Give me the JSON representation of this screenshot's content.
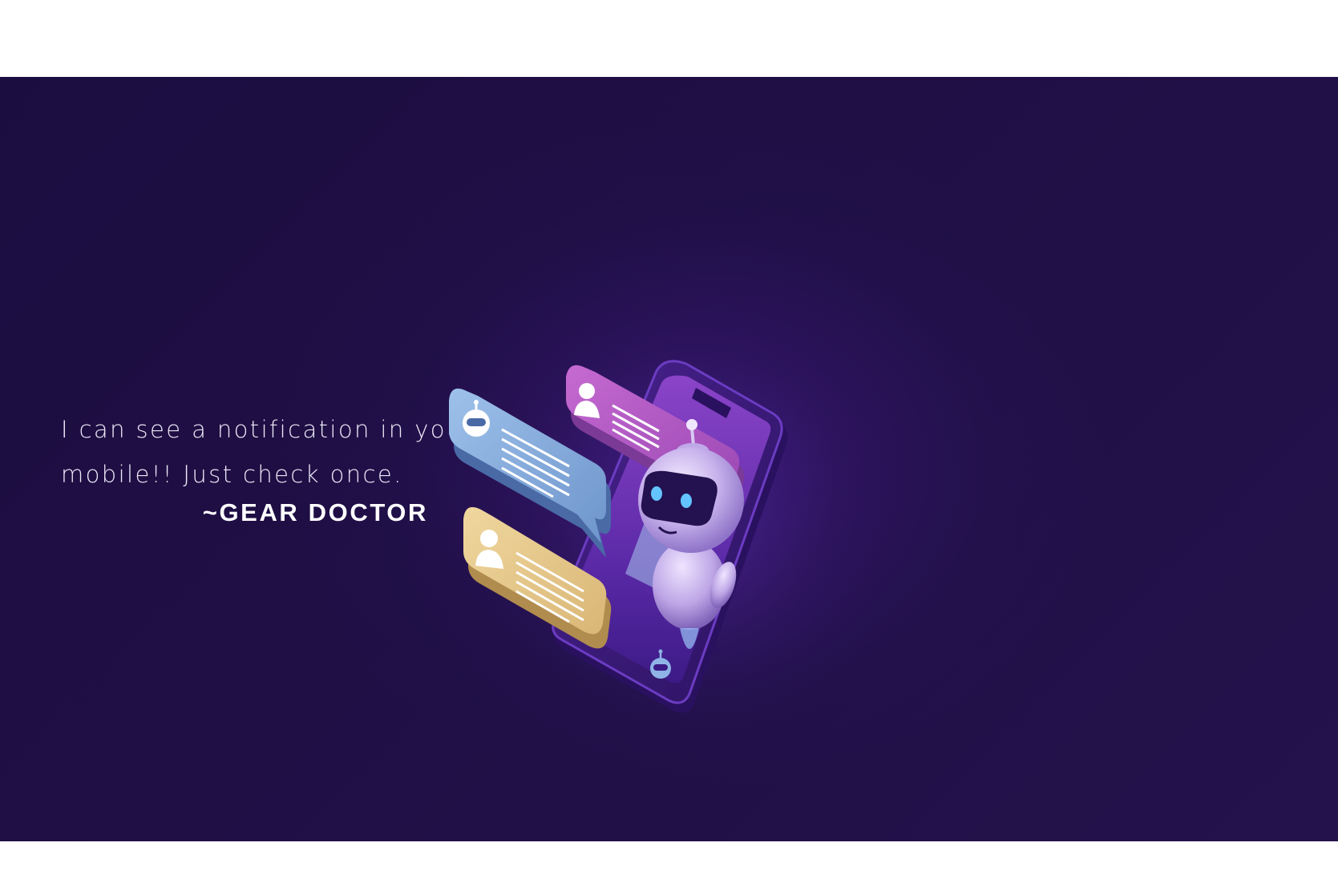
{
  "quote": {
    "line1": "I can see a notification in your",
    "line2": "mobile!! Just check once.",
    "attribution": "~GEAR DOCTOR"
  },
  "colors": {
    "background": "#21104a",
    "frame": "#ffffff",
    "bubble_blue": "#7fa6d6",
    "bubble_pink": "#b45fc0",
    "bubble_yellow": "#e6c98a",
    "phone_body": "#3b1a78",
    "robot_body": "#cbb6ee",
    "robot_eye": "#63c4ff"
  },
  "icons": {
    "bot_avatar": "robot-face-icon",
    "user_avatar": "person-silhouette-icon"
  }
}
